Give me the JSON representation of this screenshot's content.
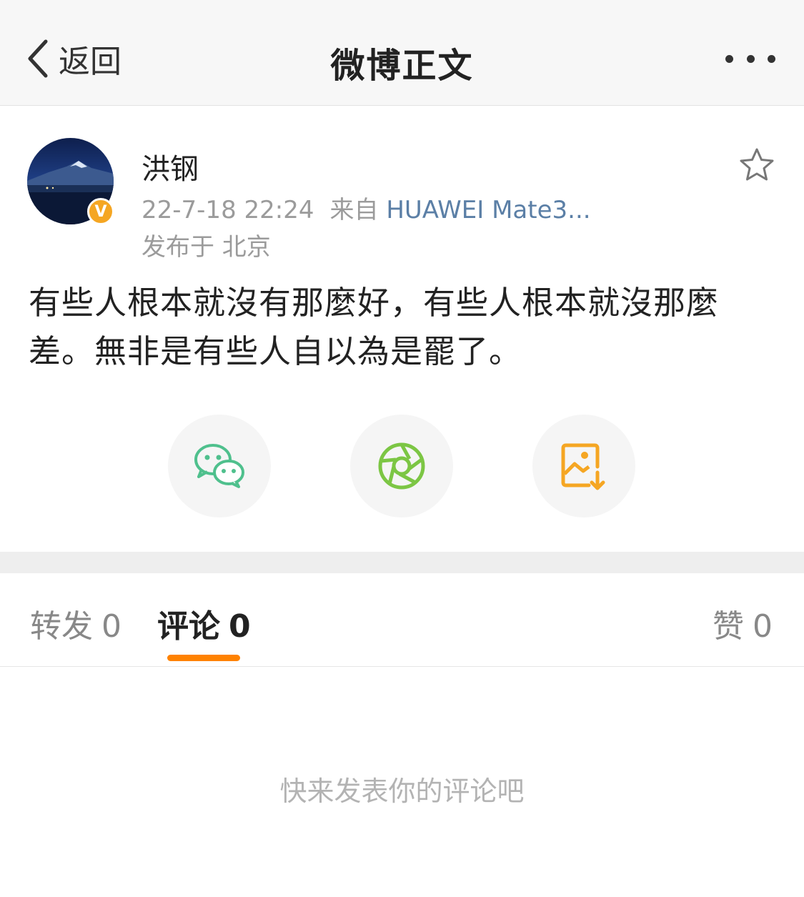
{
  "navbar": {
    "back_label": "返回",
    "title": "微博正文"
  },
  "post": {
    "author": "洪钢",
    "time": "22-7-18 22:24",
    "source_prefix": "来自",
    "source_device": "HUAWEI Mate3...",
    "location": "发布于 北京",
    "text": "有些人根本就沒有那麼好，有些人根本就沒那麼差。無非是有些人自以為是罷了。",
    "verified_badge": "V",
    "accent_colors": {
      "verified": "#f5a623",
      "source_link": "#5b7fa6",
      "tab_indicator": "#ff8200"
    }
  },
  "share": {
    "wechat_icon": "wechat-icon",
    "moments_icon": "moments-icon",
    "save_image_icon": "save-image-icon"
  },
  "tabs": {
    "repost_label": "转发",
    "repost_count": "0",
    "comment_label": "评论",
    "comment_count": "0",
    "like_label": "赞",
    "like_count": "0",
    "active": "评论"
  },
  "comments": {
    "empty_hint": "快来发表你的评论吧"
  }
}
